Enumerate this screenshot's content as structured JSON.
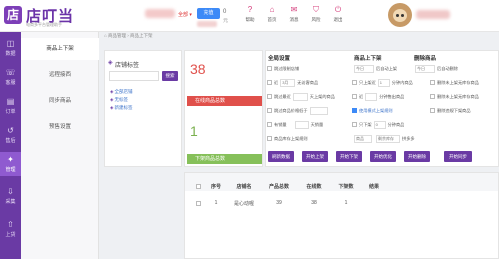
{
  "header": {
    "logo_mark": "店",
    "logo_text": "店叮当",
    "logo_sub": "电商多平台管理助手",
    "store_select": "全部 ▾",
    "search_label": "充值",
    "balance": "0",
    "balance_unit": "元",
    "nav": [
      {
        "label": "帮助",
        "icon": "help-icon",
        "glyph": "?"
      },
      {
        "label": "首页",
        "icon": "home-icon",
        "glyph": "⌂"
      },
      {
        "label": "消息",
        "icon": "message-icon",
        "glyph": "✉"
      },
      {
        "label": "风险",
        "icon": "shield-icon",
        "glyph": "⛉"
      },
      {
        "label": "退出",
        "icon": "logout-icon",
        "glyph": "⏻"
      }
    ]
  },
  "sidebar": {
    "items": [
      {
        "label": "数据",
        "icon": "chart-icon",
        "glyph": "◫"
      },
      {
        "label": "客服",
        "icon": "headset-icon",
        "glyph": "☏"
      },
      {
        "label": "订单",
        "icon": "order-icon",
        "glyph": "▤"
      },
      {
        "label": "售后",
        "icon": "aftersale-icon",
        "glyph": "↺"
      },
      {
        "label": "管理",
        "icon": "manage-icon",
        "glyph": "✦"
      },
      {
        "label": "采集",
        "icon": "collect-icon",
        "glyph": "⇩"
      },
      {
        "label": "上货",
        "icon": "upload-icon",
        "glyph": "⇧"
      }
    ],
    "active_index": 4
  },
  "subnav": {
    "items": [
      "商品上下架",
      "远程接西",
      "同步商品",
      "预售设置"
    ],
    "active_index": 0
  },
  "breadcrumb": "⌂  商品管理  ›  商品上下架",
  "tag_panel": {
    "title": "店铺标签",
    "search_button": "搜索",
    "tags": [
      "全部店铺",
      "无标签",
      "新建标签"
    ]
  },
  "stats": {
    "online_value": "38",
    "online_label": "在线商品总数",
    "offline_value": "1",
    "offline_label": "下架商品总数"
  },
  "filters": {
    "col1_title": "全局设置",
    "col2_title": "商品上下架",
    "col3_title": "删除商品",
    "row1": {
      "a": "跳过限制店铺",
      "b": "今日",
      "c": "后自动上架",
      "d": "今日",
      "e": "后自动删除"
    },
    "row2": {
      "a": "近",
      "a_val": "3月",
      "b": "无访客商品",
      "c": "只上架近",
      "c_val": "1",
      "d": "分钟内商品",
      "e": "删除未上架无库存商品"
    },
    "row3": {
      "a": "跳过最近",
      "b": "天上架的商品",
      "c": "近",
      "d": "分钟售出商品",
      "e": "删除未上架无库存商品"
    },
    "row4": {
      "a": "跳过商品价格低于",
      "b": "使用模式上架规则",
      "e": "删除违规下架商品"
    },
    "row5": {
      "a": "有销量",
      "b": "天销量",
      "c": "只下架",
      "c_val": "0",
      "d": "分钟商品"
    },
    "row6": {
      "a": "商品库存上架规则",
      "b": "商品",
      "c": "剩余库存",
      "d": "拼多多"
    }
  },
  "actions": [
    "刷新数据",
    "开始上架",
    "开始下架",
    "开始优化",
    "开始删除",
    "开始同步"
  ],
  "table": {
    "headers": [
      "序号",
      "店铺名",
      "产品总数",
      "在线数",
      "下架数",
      "结果"
    ],
    "rows": [
      {
        "index": "1",
        "shop": "是心动喔",
        "total": "39",
        "online": "38",
        "offline": "1",
        "result": ""
      }
    ]
  },
  "colors": {
    "brand": "#6a3aa4",
    "online_bar": "#e0504b",
    "offline_bar": "#86c05a",
    "online_value": "#e0504b",
    "offline_value": "#7ab04e"
  }
}
